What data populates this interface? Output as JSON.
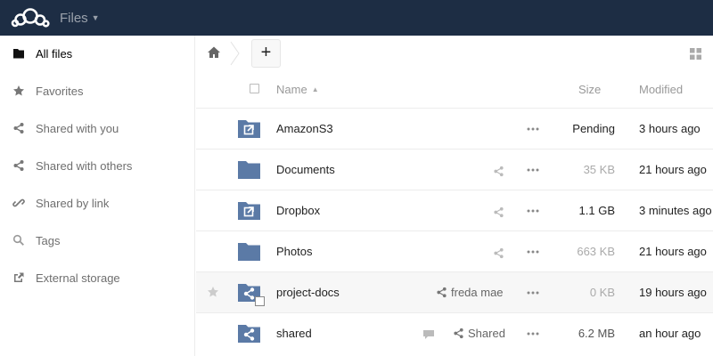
{
  "app": {
    "name": "Files"
  },
  "sidebar": {
    "items": [
      {
        "label": "All files",
        "icon": "folder-icon",
        "active": true
      },
      {
        "label": "Favorites",
        "icon": "star-icon"
      },
      {
        "label": "Shared with you",
        "icon": "share-icon"
      },
      {
        "label": "Shared with others",
        "icon": "share-icon"
      },
      {
        "label": "Shared by link",
        "icon": "link-icon"
      },
      {
        "label": "Tags",
        "icon": "search-icon"
      },
      {
        "label": "External storage",
        "icon": "external-icon"
      }
    ]
  },
  "controls": {
    "new_label": "+"
  },
  "table": {
    "headers": {
      "name": "Name",
      "size": "Size",
      "modified": "Modified"
    },
    "rows": [
      {
        "name": "AmazonS3",
        "icon": "external-folder-icon",
        "share": "",
        "size": "Pending",
        "modified": "3 hours ago"
      },
      {
        "name": "Documents",
        "icon": "folder-icon",
        "share": "",
        "size": "35 KB",
        "modified": "21 hours ago"
      },
      {
        "name": "Dropbox",
        "icon": "external-folder-icon",
        "share": "",
        "size": "1.1 GB",
        "modified": "3 minutes ago"
      },
      {
        "name": "Photos",
        "icon": "folder-icon",
        "share": "",
        "size": "663 KB",
        "modified": "21 hours ago"
      },
      {
        "name": "project-docs",
        "icon": "shared-folder-icon",
        "share": "freda mae",
        "size": "0 KB",
        "modified": "19 hours ago"
      },
      {
        "name": "shared",
        "icon": "shared-folder-icon",
        "share": "Shared",
        "size": "6.2 MB",
        "modified": "an hour ago"
      }
    ]
  },
  "colors": {
    "topbar": "#1d2d44",
    "folder": "#5b7aa6"
  }
}
